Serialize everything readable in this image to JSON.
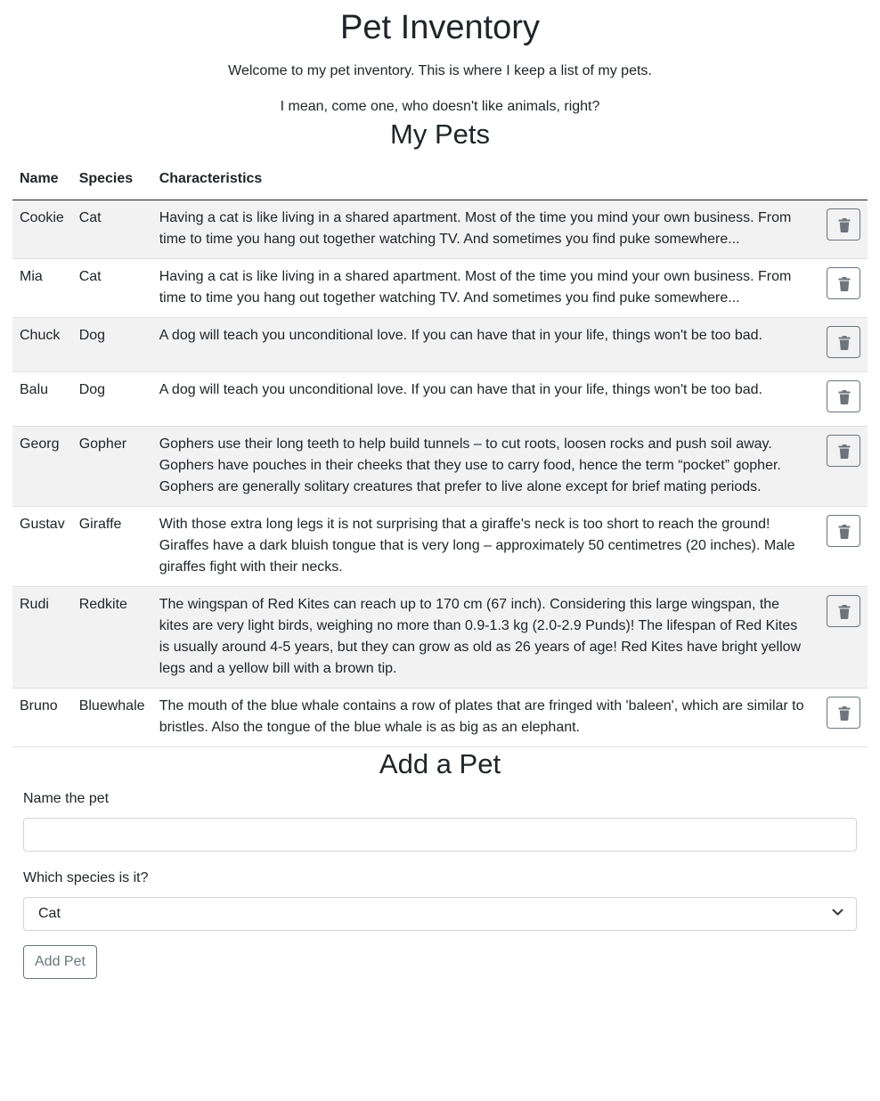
{
  "header": {
    "title": "Pet Inventory",
    "intro": "Welcome to my pet inventory. This is where I keep a list of my pets.",
    "intro2": "I mean, come one, who doesn't like animals, right?"
  },
  "pets_section": {
    "title": "My Pets",
    "columns": [
      "Name",
      "Species",
      "Characteristics"
    ],
    "rows": [
      {
        "name": "Cookie",
        "species": "Cat",
        "characteristics": "Having a cat is like living in a shared apartment. Most of the time you mind your own business. From time to time you hang out together watching TV. And sometimes you find puke somewhere..."
      },
      {
        "name": "Mia",
        "species": "Cat",
        "characteristics": "Having a cat is like living in a shared apartment. Most of the time you mind your own business. From time to time you hang out together watching TV. And sometimes you find puke somewhere..."
      },
      {
        "name": "Chuck",
        "species": "Dog",
        "characteristics": "A dog will teach you unconditional love. If you can have that in your life, things won't be too bad."
      },
      {
        "name": "Balu",
        "species": "Dog",
        "characteristics": "A dog will teach you unconditional love. If you can have that in your life, things won't be too bad."
      },
      {
        "name": "Georg",
        "species": "Gopher",
        "characteristics": "Gophers use their long teeth to help build tunnels – to cut roots, loosen rocks and push soil away. Gophers have pouches in their cheeks that they use to carry food, hence the term “pocket” gopher. Gophers are generally solitary creatures that prefer to live alone except for brief mating periods."
      },
      {
        "name": "Gustav",
        "species": "Giraffe",
        "characteristics": "With those extra long legs it is not surprising that a giraffe's neck is too short to reach the ground! Giraffes have a dark bluish tongue that is very long – approximately 50 centimetres (20 inches). Male giraffes fight with their necks."
      },
      {
        "name": "Rudi",
        "species": "Redkite",
        "characteristics": "The wingspan of Red Kites can reach up to 170 cm (67 inch). Considering this large wingspan, the kites are very light birds, weighing no more than 0.9-1.3 kg (2.0-2.9 Punds)! The lifespan of Red Kites is usually around 4-5 years, but they can grow as old as 26 years of age! Red Kites have bright yellow legs and a yellow bill with a brown tip."
      },
      {
        "name": "Bruno",
        "species": "Bluewhale",
        "characteristics": "The mouth of the blue whale contains a row of plates that are fringed with 'baleen', which are similar to bristles. Also the tongue of the blue whale is as big as an elephant."
      }
    ],
    "delete_icon": "trash-icon"
  },
  "add_section": {
    "title": "Add a Pet",
    "name_label": "Name the pet",
    "name_value": "",
    "species_label": "Which species is it?",
    "species_selected": "Cat",
    "submit_label": "Add Pet"
  },
  "colors": {
    "text": "#212529",
    "stripe": "#f2f2f2",
    "secondary": "#6c757d",
    "border": "#ced4da"
  }
}
